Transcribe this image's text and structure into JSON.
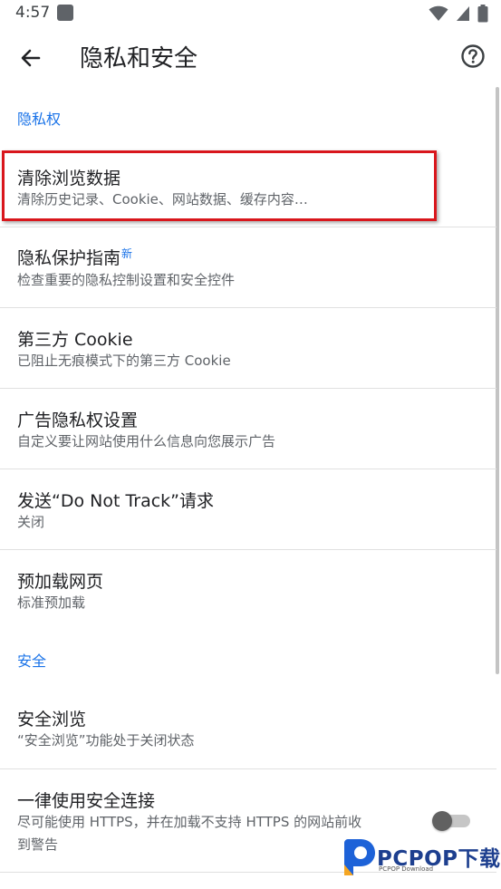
{
  "status_bar": {
    "time": "4:57"
  },
  "app_bar": {
    "title": "隐私和安全"
  },
  "sections": {
    "privacy": "隐私权",
    "security": "安全"
  },
  "items": [
    {
      "title": "清除浏览数据",
      "subtitle": "清除历史记录、Cookie、网站数据、缓存内容…"
    },
    {
      "title": "隐私保护指南",
      "badge": "新",
      "subtitle": "检查重要的隐私控制设置和安全控件"
    },
    {
      "title": "第三方 Cookie",
      "subtitle": "已阻止无痕模式下的第三方 Cookie"
    },
    {
      "title": "广告隐私权设置",
      "subtitle": "自定义要让网站使用什么信息向您展示广告"
    },
    {
      "title": "发送“Do Not Track”请求",
      "subtitle": "关闭"
    },
    {
      "title": "预加载网页",
      "subtitle": "标准预加载"
    },
    {
      "title": "安全浏览",
      "subtitle": "“安全浏览”功能处于关闭状态"
    },
    {
      "title": "一律使用安全连接",
      "subtitle_line1": "尽可能使用 HTTPS，并在加载不支持 HTTPS 的网站前收",
      "subtitle_line2": "到警告",
      "toggle_on": false
    }
  ],
  "watermark": {
    "brand": "PCPOP下载",
    "sub": "PCPOP Download"
  },
  "colors": {
    "accent": "#1a73e8",
    "highlight": "#d9161c",
    "watermark": "#1d3f8f"
  }
}
